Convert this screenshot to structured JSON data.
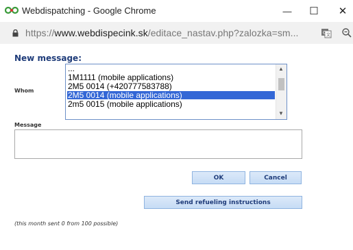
{
  "window": {
    "title": "Webdispatching - Google Chrome",
    "minimize_glyph": "—",
    "maximize_glyph": "☐",
    "close_glyph": "✕"
  },
  "address": {
    "scheme": "https://",
    "host": "www.webdispecink.sk",
    "path": "/editace_nastav.php?zalozka=sm..."
  },
  "form": {
    "heading": "New message:",
    "whom_label": "Whom",
    "message_label": "Message",
    "recipients": [
      {
        "label": "...",
        "selected": false
      },
      {
        "label": "1M1111 (mobile applications)",
        "selected": false
      },
      {
        "label": "2M5 0014 (+420777583788)",
        "selected": false
      },
      {
        "label": "2M5 0014 (mobile applications)",
        "selected": true
      },
      {
        "label": "2m5 0015 (mobile applications)",
        "selected": false
      }
    ],
    "message_value": "",
    "ok_label": "OK",
    "cancel_label": "Cancel",
    "refuel_label": "Send refueling instructions",
    "note": "(this month sent 0 from 100 possible)"
  },
  "icons": {
    "app": "webdispatching-app-icon",
    "lock": "lock-icon",
    "translate": "translate-icon",
    "zoom": "zoom-icon"
  },
  "colors": {
    "heading": "#1f3c7a",
    "selection": "#3367d6",
    "button_bg": "#c6dcf5"
  }
}
